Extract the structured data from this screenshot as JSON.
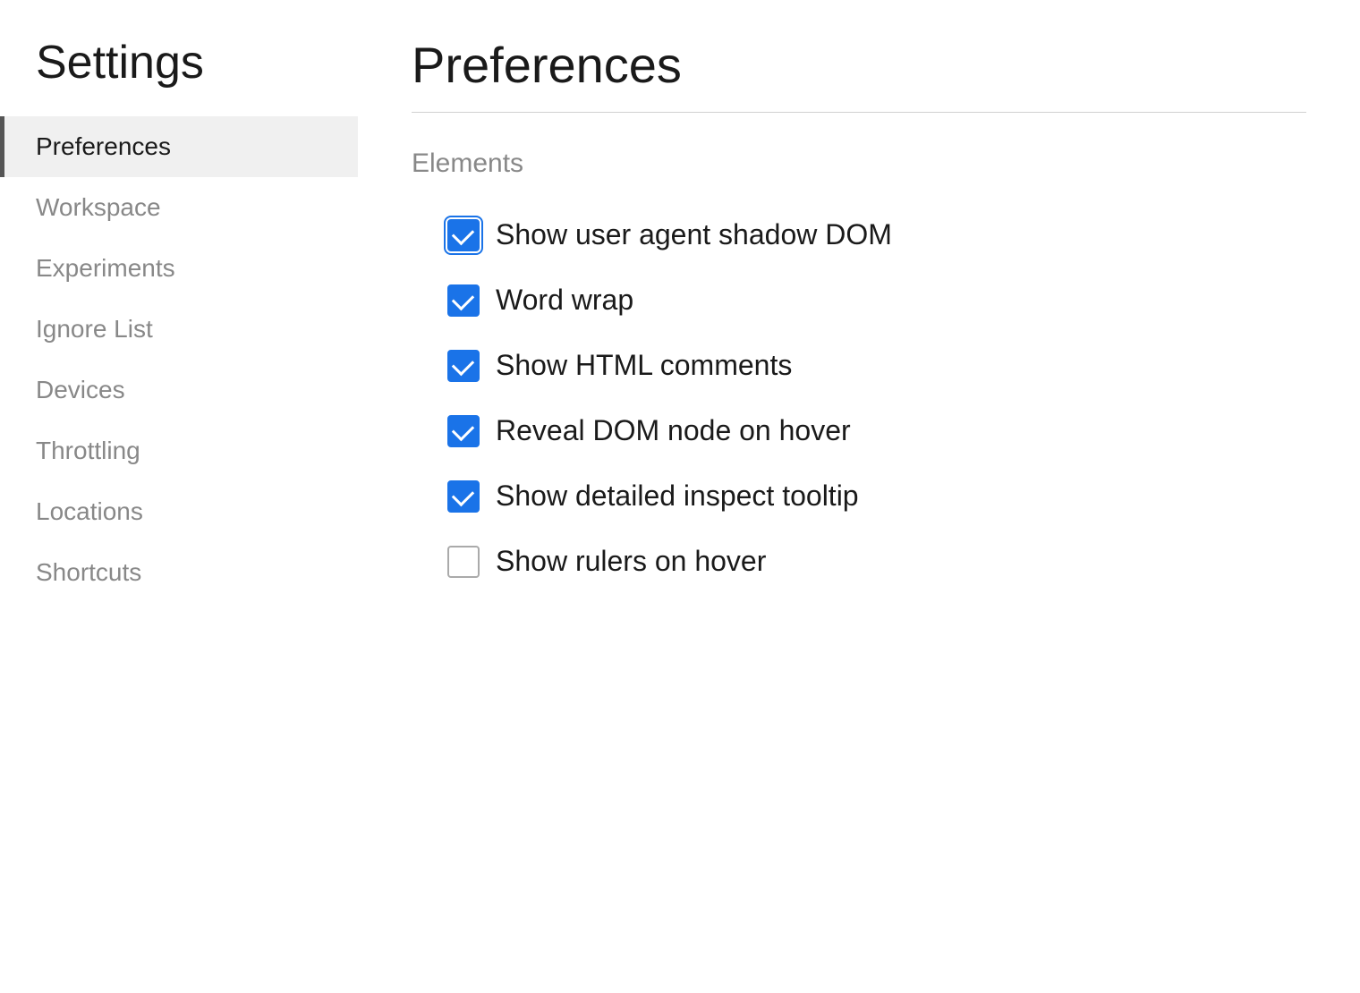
{
  "sidebar": {
    "title": "Settings",
    "items": [
      {
        "id": "preferences",
        "label": "Preferences",
        "active": true
      },
      {
        "id": "workspace",
        "label": "Workspace",
        "active": false
      },
      {
        "id": "experiments",
        "label": "Experiments",
        "active": false
      },
      {
        "id": "ignore-list",
        "label": "Ignore List",
        "active": false
      },
      {
        "id": "devices",
        "label": "Devices",
        "active": false
      },
      {
        "id": "throttling",
        "label": "Throttling",
        "active": false
      },
      {
        "id": "locations",
        "label": "Locations",
        "active": false
      },
      {
        "id": "shortcuts",
        "label": "Shortcuts",
        "active": false
      }
    ]
  },
  "main": {
    "title": "Preferences",
    "sections": [
      {
        "id": "elements",
        "title": "Elements",
        "checkboxes": [
          {
            "id": "show-user-agent-shadow-dom",
            "label": "Show user agent shadow DOM",
            "checked": true,
            "first": true
          },
          {
            "id": "word-wrap",
            "label": "Word wrap",
            "checked": true
          },
          {
            "id": "show-html-comments",
            "label": "Show HTML comments",
            "checked": true
          },
          {
            "id": "reveal-dom-node-on-hover",
            "label": "Reveal DOM node on hover",
            "checked": true
          },
          {
            "id": "show-detailed-inspect-tooltip",
            "label": "Show detailed inspect tooltip",
            "checked": true
          },
          {
            "id": "show-rulers-on-hover",
            "label": "Show rulers on hover",
            "checked": false
          }
        ]
      }
    ]
  }
}
